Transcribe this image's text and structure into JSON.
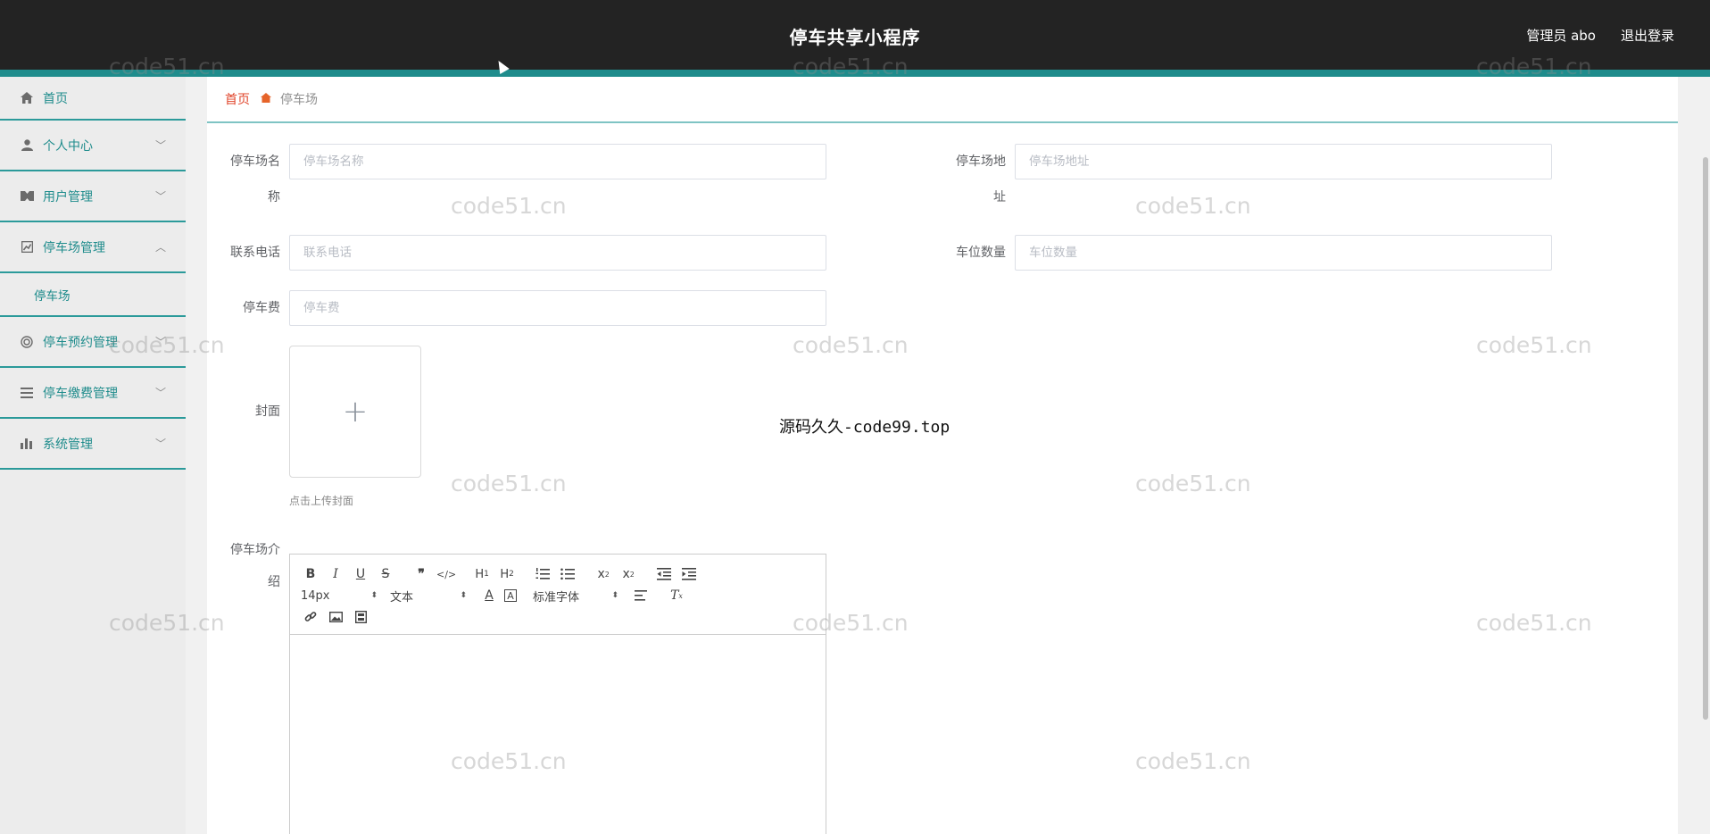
{
  "header": {
    "title": "停车共享小程序",
    "user": "管理员 abo",
    "logout": "退出登录"
  },
  "sidebar": {
    "items": [
      {
        "label": "首页",
        "icon": "home-icon"
      },
      {
        "label": "个人中心",
        "icon": "user-icon"
      },
      {
        "label": "用户管理",
        "icon": "users-icon"
      },
      {
        "label": "停车场管理",
        "icon": "chart-icon"
      },
      {
        "label": "停车预约管理",
        "icon": "target-icon"
      },
      {
        "label": "停车缴费管理",
        "icon": "list-icon"
      },
      {
        "label": "系统管理",
        "icon": "bar-chart-icon"
      }
    ],
    "submenu": {
      "label": "停车场"
    }
  },
  "breadcrumb": {
    "home": "首页",
    "current": "停车场"
  },
  "form": {
    "name_label": "停车场名称",
    "name_placeholder": "停车场名称",
    "address_label": "停车场地址",
    "address_placeholder": "停车场地址",
    "phone_label": "联系电话",
    "phone_placeholder": "联系电话",
    "spaces_label": "车位数量",
    "spaces_placeholder": "车位数量",
    "fee_label": "停车费",
    "fee_placeholder": "停车费",
    "cover_label": "封面",
    "cover_hint": "点击上传封面",
    "intro_label": "停车场介绍"
  },
  "editor": {
    "font_size": "14px",
    "paragraph": "文本",
    "font_family": "标准字体"
  },
  "overlay": "源码久久-code99.top",
  "watermark": "code51.cn"
}
